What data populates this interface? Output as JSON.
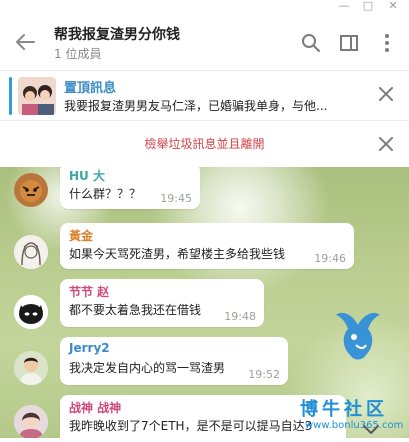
{
  "window": {
    "minimize_glyph": "—",
    "maximize_glyph": "□",
    "close_glyph": "✕"
  },
  "header": {
    "title": "帮我报复渣男分你钱",
    "subtitle": "1 位成員",
    "icons": [
      "back-arrow-icon",
      "search-icon",
      "sidebar-toggle-icon",
      "more-vertical-icon"
    ]
  },
  "pinned": {
    "title": "置頂訊息",
    "text": "我要报复渣男男友马仁泽，已婚骗我单身，与他..."
  },
  "action": {
    "label": "檢舉垃圾訊息並且離開"
  },
  "messages": [
    {
      "name": "HU 大",
      "text": "什么群？？？",
      "time": "19:45",
      "name_color": "#3aa8a0"
    },
    {
      "name": "黃金",
      "text": "如果今天骂死渣男，希望楼主多给我些钱",
      "time": "19:46",
      "name_color": "#d8822a"
    },
    {
      "name": "节节 赵",
      "text": "都不要太着急我还在借钱",
      "time": "19:48",
      "name_color": "#cf4a7a"
    },
    {
      "name": "Jerry2",
      "text": "我决定发自内心的骂一骂渣男",
      "time": "19:52",
      "name_color": "#3a8cc7"
    },
    {
      "name": "战神 战神",
      "text": "我昨晚收到了7个ETH，是不是可以提马自达3",
      "time": "",
      "name_color": "#cf4a7a"
    }
  ],
  "watermark": {
    "brand": "博牛社区",
    "url": "www.bonlu365.com"
  },
  "colors": {
    "accent": "#3a8cc7",
    "danger": "#d3434a",
    "bubble": "#ffffff"
  }
}
